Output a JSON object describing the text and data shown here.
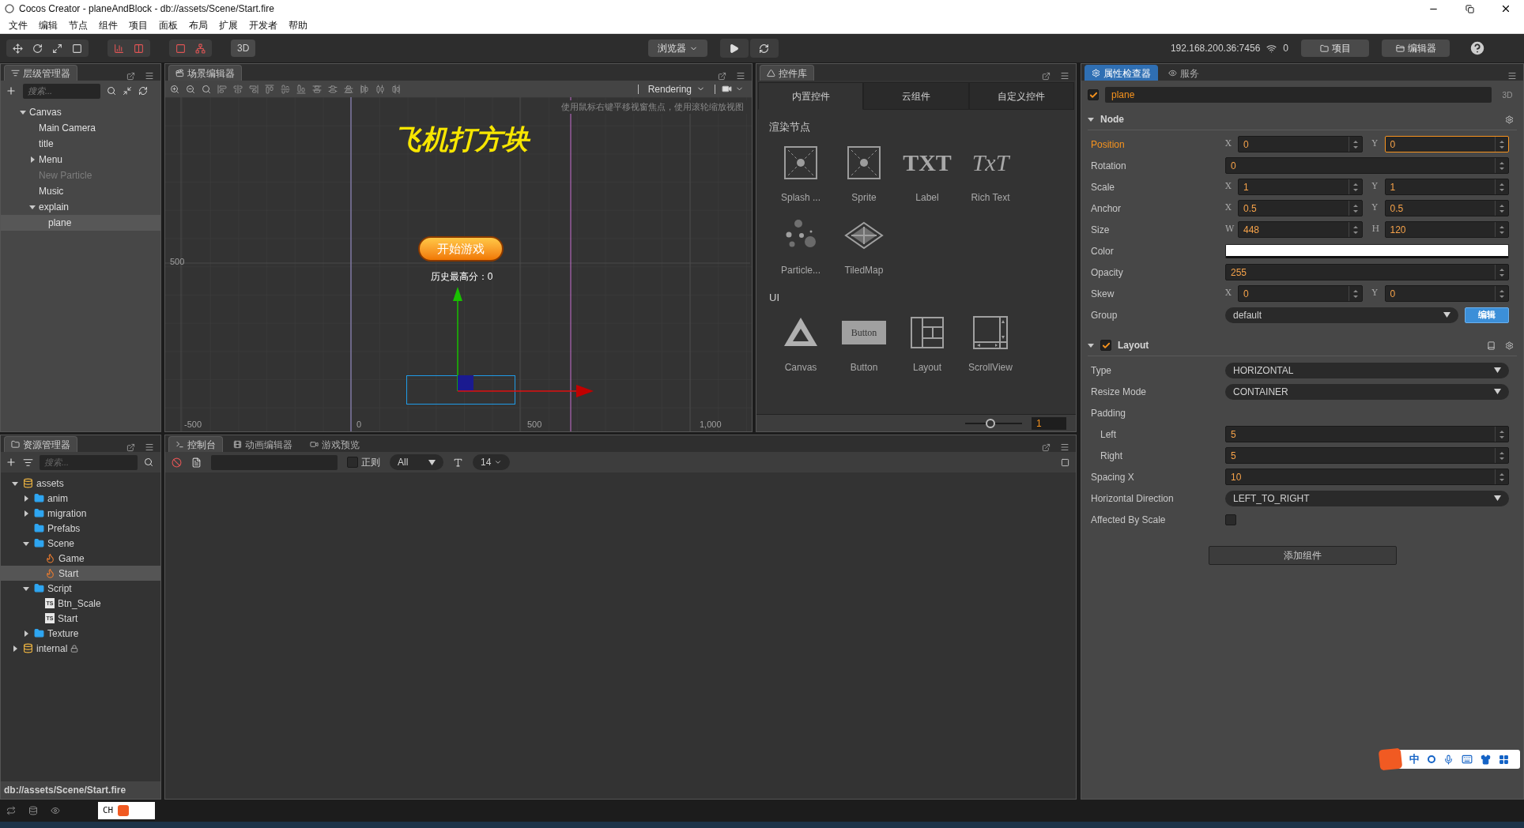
{
  "window": {
    "title": "Cocos Creator - planeAndBlock - db://assets/Scene/Start.fire"
  },
  "menu": [
    "文件",
    "编辑",
    "节点",
    "组件",
    "项目",
    "面板",
    "布局",
    "扩展",
    "开发者",
    "帮助"
  ],
  "toolbar": {
    "view_3d": "3D",
    "preview": "浏览器",
    "ip": "192.168.200.36:7456",
    "connections": "0",
    "buttons": [
      {
        "label": "项目",
        "kind": "project"
      },
      {
        "label": "编辑器",
        "kind": "editor"
      }
    ]
  },
  "hierarchy": {
    "title": "层级管理器",
    "search_placeholder": "搜索...",
    "nodes": [
      {
        "label": "Canvas",
        "expanded": true,
        "selected": false,
        "active": true,
        "children": [
          {
            "label": "Main Camera",
            "selected": false,
            "active": true
          },
          {
            "label": "title",
            "selected": false,
            "active": true
          },
          {
            "label": "Menu",
            "expanded": false,
            "selected": false,
            "active": true
          },
          {
            "label": "New Particle",
            "selected": false,
            "active": false
          },
          {
            "label": "Music",
            "selected": false,
            "active": true
          },
          {
            "label": "explain",
            "expanded": true,
            "selected": false,
            "active": true,
            "children": [
              {
                "label": "plane",
                "selected": true,
                "active": true
              }
            ]
          }
        ]
      }
    ]
  },
  "scene": {
    "title": "场景编辑器",
    "render_mode": "Rendering",
    "hint": "使用鼠标右键平移视窗焦点，使用滚轮缩放视图",
    "game_title": "飞机打方块",
    "start_button": "开始游戏",
    "best_score": "历史最高分：0",
    "axis_labels": [
      {
        "kind": "y",
        "label": "500"
      },
      {
        "kind": "x",
        "label": "-500"
      },
      {
        "kind": "x",
        "label": "0"
      },
      {
        "kind": "x",
        "label": "500"
      },
      {
        "kind": "x",
        "label": "1,000"
      }
    ]
  },
  "controls": {
    "title": "控件库",
    "tabs": [
      {
        "label": "内置控件",
        "selected": true
      },
      {
        "label": "云组件",
        "selected": false
      },
      {
        "label": "自定义控件",
        "selected": false
      }
    ],
    "sections": [
      {
        "title": "渲染节点",
        "items": [
          {
            "label": "Splash ...",
            "kind": "sprite"
          },
          {
            "label": "Sprite",
            "kind": "sprite"
          },
          {
            "label": "Label",
            "kind": "txt",
            "glyph": "TXT"
          },
          {
            "label": "Rich Text",
            "kind": "richtext",
            "glyph": "TxT"
          },
          {
            "label": "Particle...",
            "kind": "particle"
          },
          {
            "label": "TiledMap",
            "kind": "tiledmap"
          }
        ]
      },
      {
        "title": "UI",
        "items": [
          {
            "label": "Canvas",
            "kind": "canvas"
          },
          {
            "label": "Button",
            "kind": "button",
            "glyph": "Button"
          },
          {
            "label": "Layout",
            "kind": "layout"
          },
          {
            "label": "ScrollView",
            "kind": "scrollview"
          }
        ]
      }
    ],
    "zoom": {
      "level": 0.45,
      "value": "1"
    }
  },
  "inspector": {
    "tabs": [
      {
        "label": "属性检查器",
        "selected": true,
        "kind": "gear"
      },
      {
        "label": "服务",
        "selected": false,
        "kind": "service"
      }
    ],
    "node": {
      "enabled": true,
      "name": "plane",
      "mode": "3D"
    },
    "sections": [
      {
        "title": "Node",
        "expanded": true,
        "props": [
          {
            "label": "Position",
            "kind": "vec",
            "active": true,
            "fields": [
              {
                "axis": "X",
                "value": "0",
                "focused": false
              },
              {
                "axis": "Y",
                "value": "0",
                "focused": true
              }
            ]
          },
          {
            "label": "Rotation",
            "kind": "number",
            "active": false,
            "value": "0"
          },
          {
            "label": "Scale",
            "kind": "vec",
            "active": false,
            "fields": [
              {
                "axis": "X",
                "value": "1",
                "focused": false
              },
              {
                "axis": "Y",
                "value": "1",
                "focused": false
              }
            ]
          },
          {
            "label": "Anchor",
            "kind": "vec",
            "active": false,
            "fields": [
              {
                "axis": "X",
                "value": "0.5",
                "focused": false
              },
              {
                "axis": "Y",
                "value": "0.5",
                "focused": false
              }
            ]
          },
          {
            "label": "Size",
            "kind": "vec",
            "active": false,
            "fields": [
              {
                "axis": "W",
                "value": "448",
                "focused": false
              },
              {
                "axis": "H",
                "value": "120",
                "focused": false
              }
            ]
          },
          {
            "label": "Color",
            "kind": "color",
            "active": false,
            "color": "#ffffff"
          },
          {
            "label": "Opacity",
            "kind": "number",
            "active": false,
            "value": "255"
          },
          {
            "label": "Skew",
            "kind": "vec",
            "active": false,
            "fields": [
              {
                "axis": "X",
                "value": "0",
                "focused": false
              },
              {
                "axis": "Y",
                "value": "0",
                "focused": false
              }
            ]
          },
          {
            "label": "Group",
            "kind": "select",
            "active": false,
            "value": "default",
            "button": "编辑"
          }
        ]
      },
      {
        "title": "Layout",
        "expanded": true,
        "enabled": true,
        "props": [
          {
            "label": "Type",
            "kind": "select",
            "value": "HORIZONTAL"
          },
          {
            "label": "Resize Mode",
            "kind": "select",
            "value": "CONTAINER"
          },
          {
            "label": "Padding",
            "kind": "group",
            "children": [
              {
                "label": "Left",
                "kind": "number",
                "value": "5"
              },
              {
                "label": "Right",
                "kind": "number",
                "value": "5"
              }
            ]
          },
          {
            "label": "Spacing X",
            "kind": "number",
            "value": "10"
          },
          {
            "label": "Horizontal Direction",
            "kind": "select",
            "value": "LEFT_TO_RIGHT"
          },
          {
            "label": "Affected By Scale",
            "kind": "checkbox",
            "checked": false
          }
        ]
      }
    ],
    "add_button": "添加组件"
  },
  "assets": {
    "title": "资源管理器",
    "search_placeholder": "搜索...",
    "path": "db://assets/Scene/Start.fire",
    "nodes": [
      {
        "label": "assets",
        "kind": "db",
        "locked": false,
        "expanded": true,
        "selected": false,
        "children": [
          {
            "label": "anim",
            "kind": "folder",
            "expanded": false,
            "selected": false
          },
          {
            "label": "migration",
            "kind": "folder",
            "expanded": false,
            "selected": false
          },
          {
            "label": "Prefabs",
            "kind": "folder",
            "selected": false
          },
          {
            "label": "Scene",
            "kind": "folder",
            "expanded": true,
            "selected": false,
            "children": [
              {
                "label": "Game",
                "kind": "scene",
                "selected": false
              },
              {
                "label": "Start",
                "kind": "scene",
                "selected": true
              }
            ]
          },
          {
            "label": "Script",
            "kind": "folder",
            "expanded": true,
            "selected": false,
            "children": [
              {
                "label": "Btn_Scale",
                "kind": "script",
                "badge": "TS",
                "selected": false
              },
              {
                "label": "Start",
                "kind": "script",
                "badge": "TS",
                "selected": false
              }
            ]
          },
          {
            "label": "Texture",
            "kind": "folder",
            "expanded": false,
            "selected": false
          }
        ]
      },
      {
        "label": "internal",
        "kind": "db",
        "locked": true,
        "expanded": false,
        "selected": false
      }
    ]
  },
  "console": {
    "tabs": [
      {
        "label": "控制台",
        "selected": true,
        "kind": "console"
      },
      {
        "label": "动画编辑器",
        "selected": false,
        "kind": "animation"
      },
      {
        "label": "游戏预览",
        "selected": false,
        "kind": "preview"
      }
    ],
    "regex": {
      "label": "正则",
      "checked": false
    },
    "level_filter": "All",
    "font_size": "14"
  },
  "status_bar": {
    "ime": "CH"
  },
  "ime_toolbar": {
    "mode": "中"
  }
}
